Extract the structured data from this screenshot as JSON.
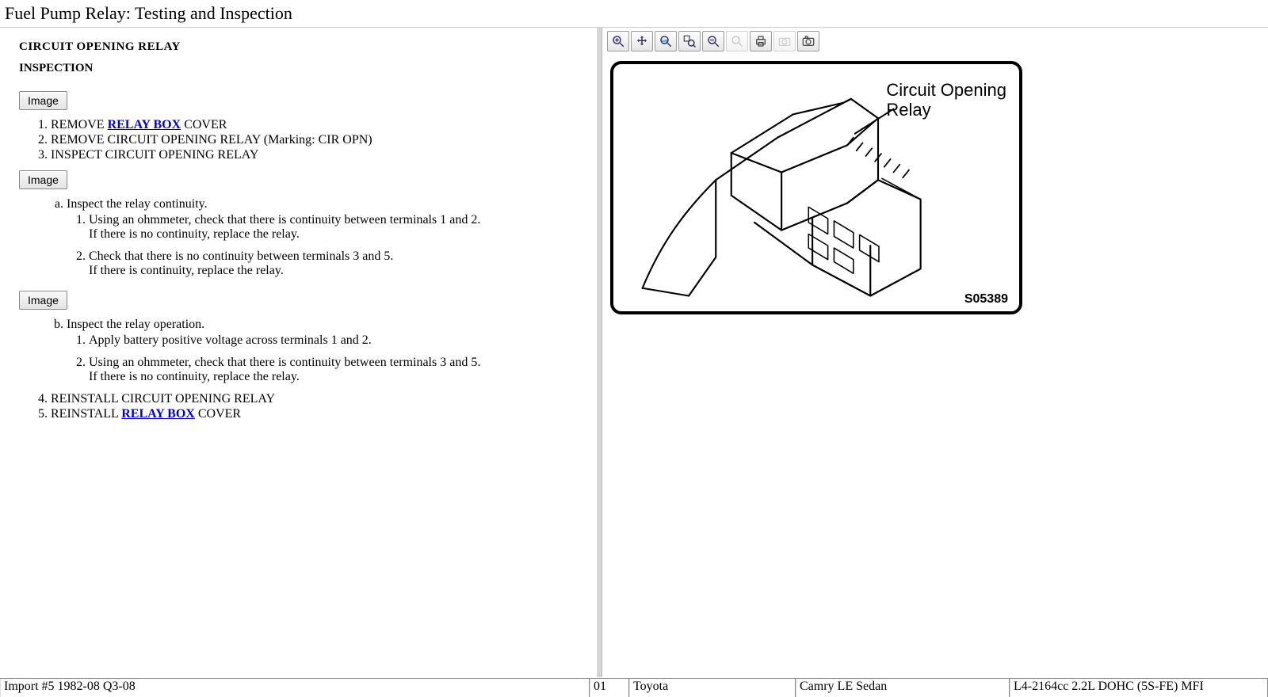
{
  "page": {
    "title": "Fuel Pump Relay:  Testing and Inspection"
  },
  "left": {
    "section_title": "CIRCUIT OPENING RELAY",
    "inspection_title": "INSPECTION",
    "image_button": "Image",
    "link_relay_box": "RELAY BOX",
    "steps": {
      "s1_pre": "REMOVE ",
      "s1_post": " COVER",
      "s2": "REMOVE CIRCUIT OPENING RELAY (Marking: CIR OPN)",
      "s3": "INSPECT CIRCUIT OPENING RELAY",
      "a_title": "Inspect the relay continuity.",
      "a1_l1": "Using an ohmmeter, check that there is continuity between terminals 1 and 2.",
      "a1_l2": "If there is no continuity, replace the relay.",
      "a2_l1": "Check that there is no continuity between terminals 3 and 5.",
      "a2_l2": "If there is continuity, replace the relay.",
      "b_title": "Inspect the relay operation.",
      "b1": "Apply battery positive voltage across terminals 1 and 2.",
      "b2_l1": "Using an ohmmeter, check that there is continuity between terminals 3 and 5.",
      "b2_l2": "If there is no continuity, replace the relay.",
      "s4": "REINSTALL CIRCUIT OPENING RELAY",
      "s5_pre": "REINSTALL ",
      "s5_post": " COVER"
    }
  },
  "toolbar": {
    "items": [
      {
        "name": "zoom-in-icon"
      },
      {
        "name": "pan-icon"
      },
      {
        "name": "zoom-100-icon"
      },
      {
        "name": "zoom-region-icon"
      },
      {
        "name": "zoom-out-step-icon"
      },
      {
        "name": "zoom-disabled-icon",
        "disabled": true
      },
      {
        "name": "print-icon"
      },
      {
        "name": "camera-disabled-icon",
        "disabled": true
      },
      {
        "name": "gallery-icon"
      }
    ]
  },
  "diagram": {
    "label_l1": "Circuit Opening",
    "label_l2": "Relay",
    "code": "S05389"
  },
  "status": {
    "c1": "Import #5 1982-08 Q3-08",
    "c2": "01",
    "c3": "Toyota",
    "c4": "Camry LE Sedan",
    "c5": "L4-2164cc 2.2L DOHC (5S-FE) MFI"
  }
}
